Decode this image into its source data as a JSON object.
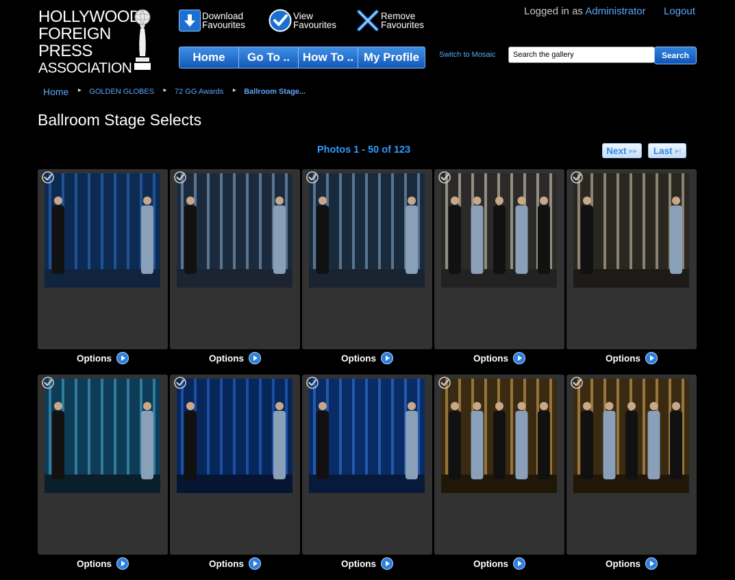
{
  "logo": {
    "lines": [
      "HOLLYWOOD",
      "FOREIGN",
      "PRESS",
      "ASSOCIATION"
    ]
  },
  "actions": {
    "download": {
      "line1": "Download",
      "line2": "Favourites",
      "icon": "download-arrow-icon"
    },
    "view": {
      "line1": "View",
      "line2": "Favourites",
      "icon": "checkmark-circle-icon"
    },
    "remove": {
      "line1": "Remove",
      "line2": "Favourites",
      "icon": "x-mark-icon"
    }
  },
  "nav": [
    "Home",
    "Go To ..",
    "How To ..",
    "My Profile"
  ],
  "user": {
    "prefix": "Logged in as",
    "name": "Administrator",
    "logout": "Logout"
  },
  "mosaic_link": "Switch to Mosaic",
  "search": {
    "value": "Search the gallery",
    "button": "Search"
  },
  "breadcrumb": {
    "home": "Home",
    "items": [
      "GOLDEN GLOBES",
      "72 GG Awards"
    ],
    "current": "Ballroom Stage..."
  },
  "page_title": "Ballroom Stage Selects",
  "pagination": {
    "summary": "Photos 1 - 50 of 123",
    "next": "Next",
    "last": "Last"
  },
  "options_label": "Options",
  "colors": {
    "accent_blue": "#2f9bff",
    "link_blue": "#5aa8ff",
    "card_bg": "#323232",
    "nav_blue": "#1b6fd0"
  },
  "photos": [
    {
      "scene": "woman-in-silver-gown-and-man-in-tuxedo-onstage"
    },
    {
      "scene": "presenters-onstage-man-and-woman"
    },
    {
      "scene": "presenters-onstage-man-and-woman"
    },
    {
      "scene": "man-and-two-women-onstage"
    },
    {
      "scene": "two-men-in-tuxedos-onstage"
    },
    {
      "scene": "ballroom-wide-stage-view"
    },
    {
      "scene": "winner-holding-award"
    },
    {
      "scene": "presenters-exchange-onstage"
    },
    {
      "scene": "group-onstage-gold-backdrop"
    },
    {
      "scene": "group-onstage-gold-backdrop"
    }
  ]
}
